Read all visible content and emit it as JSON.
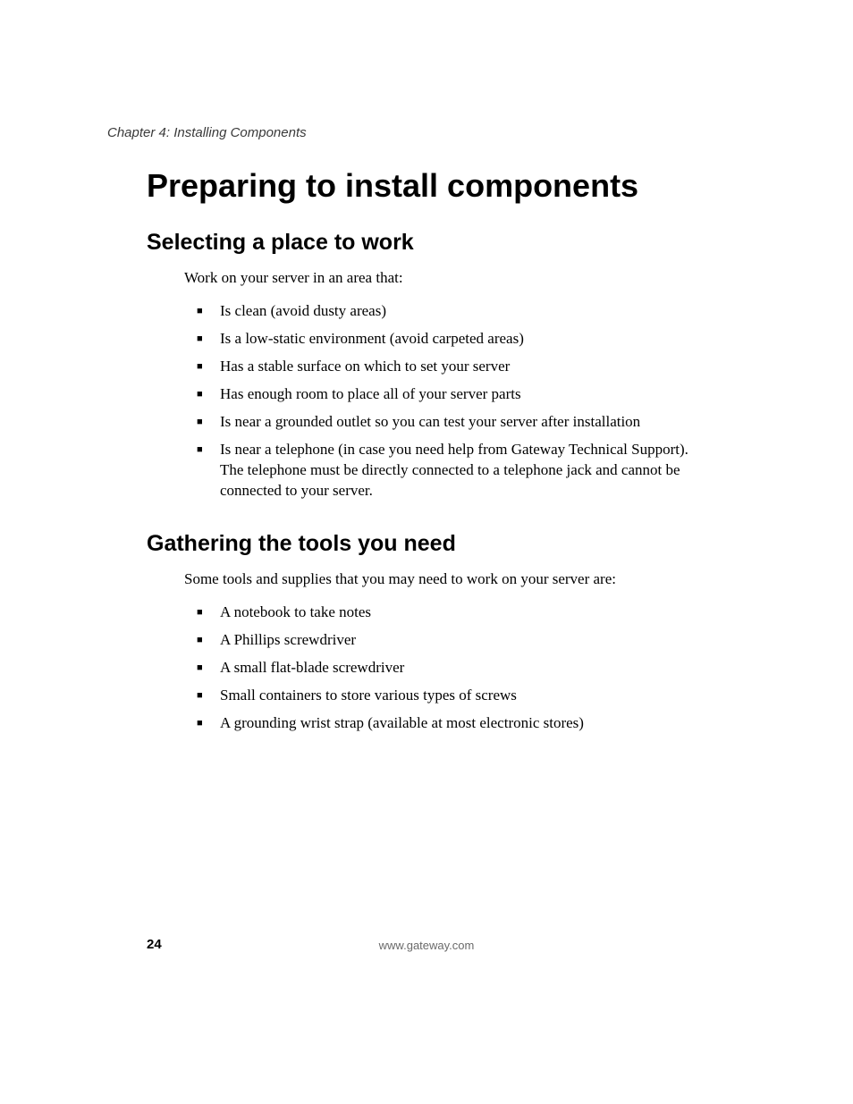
{
  "header": {
    "running": "Chapter 4: Installing Components"
  },
  "title": "Preparing to install components",
  "sections": [
    {
      "heading": "Selecting a place to work",
      "intro": "Work on your server in an area that:",
      "items": [
        "Is clean (avoid dusty areas)",
        "Is a low-static environment (avoid carpeted areas)",
        "Has a stable surface on which to set your server",
        "Has enough room to place all of your server parts",
        "Is near a grounded outlet so you can test your server after installation",
        "Is near a telephone (in case you need help from Gateway Technical Support). The telephone must be directly connected to a telephone jack and cannot be connected to your server."
      ]
    },
    {
      "heading": "Gathering the tools you need",
      "intro": "Some tools and supplies that you may need to work on your server are:",
      "items": [
        "A notebook to take notes",
        "A Phillips screwdriver",
        "A small flat-blade screwdriver",
        "Small containers to store various types of screws",
        "A grounding wrist strap (available at most electronic stores)"
      ]
    }
  ],
  "footer": {
    "page_number": "24",
    "url": "www.gateway.com"
  }
}
